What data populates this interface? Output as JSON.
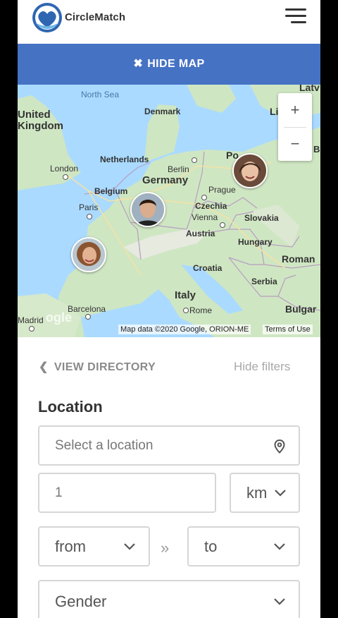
{
  "header": {
    "brand": "CircleMatch",
    "menu_icon": "hamburger-menu-icon"
  },
  "map_toggle": {
    "icon": "close-icon",
    "label": "HIDE MAP"
  },
  "map": {
    "labels": {
      "north_sea": "North Sea",
      "united_kingdom": "United\nKingdom",
      "denmark": "Denmark",
      "latvia_partial": "Latv",
      "lithuania_partial": "Li",
      "lithuania_partial2": "ia",
      "belarus_partial": "B",
      "netherlands": "Netherlands",
      "london": "London",
      "berlin": "Berlin",
      "poland_partial": "Po",
      "poland_partial2": "d",
      "germany": "Germany",
      "belgium": "Belgium",
      "prague": "Prague",
      "paris": "Paris",
      "czechia": "Czechia",
      "vienna": "Vienna",
      "slovakia": "Slovakia",
      "austria": "Austria",
      "hungary": "Hungary",
      "romania_partial": "Roman",
      "france_partial": "e",
      "croatia": "Croatia",
      "serbia": "Serbia",
      "italy": "Italy",
      "barcelona": "Barcelona",
      "rome": "Rome",
      "bulgaria_partial": "Bulgar",
      "madrid": "Madrid",
      "google_wm": "ogle"
    },
    "zoom_in": "+",
    "zoom_out": "−",
    "attribution": "Map data ©2020 Google, ORION-ME",
    "terms": "Terms of Use"
  },
  "filters": {
    "view_directory": "VIEW DIRECTORY",
    "hide_filters": "Hide filters",
    "location_heading": "Location",
    "location_placeholder": "Select a location",
    "distance_value": "1",
    "unit": "km",
    "age_from": "from",
    "range_separator": "»",
    "age_to": "to",
    "gender": "Gender"
  },
  "colors": {
    "accent": "#4672c4",
    "water": "#aadaff",
    "land": "#cfe6c3"
  }
}
